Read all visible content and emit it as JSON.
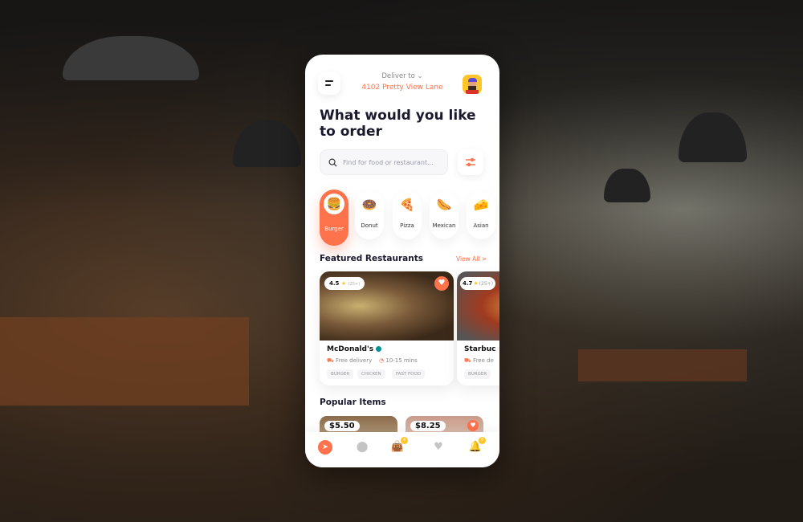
{
  "colors": {
    "accent": "#fe724c",
    "badge": "#ffc529",
    "verified": "#029094"
  },
  "header": {
    "deliver_label": "Deliver to",
    "address": "4102  Pretty View Lane",
    "menu_icon": "menu-icon",
    "avatar_icon": "avatar"
  },
  "title": "What would you like to order",
  "search": {
    "placeholder": "Find for food or restaurant...",
    "filter_icon": "filter-icon"
  },
  "categories": [
    {
      "label": "Burger",
      "icon": "🍔",
      "active": true
    },
    {
      "label": "Donut",
      "icon": "🍩"
    },
    {
      "label": "Pizza",
      "icon": "🍕"
    },
    {
      "label": "Mexican",
      "icon": "🌭"
    },
    {
      "label": "Asian",
      "icon": "🧀"
    }
  ],
  "featured": {
    "title": "Featured Restaurants",
    "view_all": "View All >",
    "restaurants": [
      {
        "name": "McDonald's",
        "rating": "4.5",
        "count": "(25+)",
        "delivery": "Free delivery",
        "time": "10-15 mins",
        "tags": [
          "BURGER",
          "CHICKEN",
          "FAST FOOD"
        ],
        "favorite": true
      },
      {
        "name": "Starbuc",
        "rating": "4.7",
        "count": "(25+)",
        "delivery": "Free de",
        "tags": [
          "BURGER"
        ]
      }
    ]
  },
  "popular": {
    "title": "Popular Items",
    "items": [
      {
        "price": "$5.50"
      },
      {
        "price": "$8.25"
      }
    ]
  },
  "nav": {
    "items": [
      "compass-icon",
      "location-icon",
      "bag-icon",
      "heart-icon",
      "bell-icon"
    ],
    "bag_badge": "4",
    "bell_badge": "6"
  }
}
